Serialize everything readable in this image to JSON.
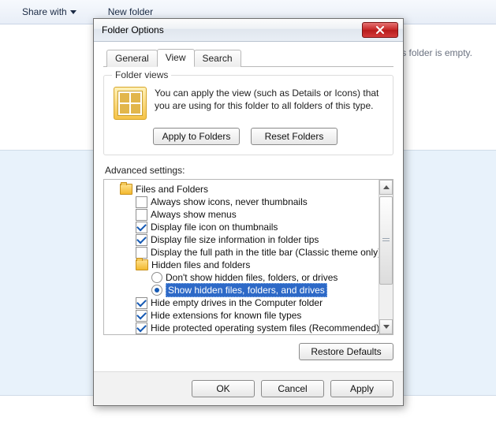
{
  "background": {
    "share_with": "Share with",
    "new_folder": "New folder",
    "empty_hint": "s folder is empty."
  },
  "dialog": {
    "title": "Folder Options",
    "tabs": {
      "general": "General",
      "view": "View",
      "search": "Search"
    },
    "folder_views": {
      "group_label": "Folder views",
      "description": "You can apply the view (such as Details or Icons) that you are using for this folder to all folders of this type.",
      "apply_btn": "Apply to Folders",
      "reset_btn": "Reset Folders"
    },
    "advanced": {
      "label": "Advanced settings:",
      "root": "Files and Folders",
      "items": [
        {
          "type": "check",
          "checked": false,
          "label": "Always show icons, never thumbnails"
        },
        {
          "type": "check",
          "checked": false,
          "label": "Always show menus"
        },
        {
          "type": "check",
          "checked": true,
          "label": "Display file icon on thumbnails"
        },
        {
          "type": "check",
          "checked": true,
          "label": "Display file size information in folder tips"
        },
        {
          "type": "check",
          "checked": false,
          "label": "Display the full path in the title bar (Classic theme only)"
        }
      ],
      "hidden_group": "Hidden files and folders",
      "radios": [
        {
          "checked": false,
          "label": "Don't show hidden files, folders, or drives"
        },
        {
          "checked": true,
          "label": "Show hidden files, folders, and drives",
          "selected": true
        }
      ],
      "items2": [
        {
          "type": "check",
          "checked": true,
          "label": "Hide empty drives in the Computer folder"
        },
        {
          "type": "check",
          "checked": true,
          "label": "Hide extensions for known file types"
        },
        {
          "type": "check",
          "checked": true,
          "label": "Hide protected operating system files (Recommended)"
        }
      ],
      "restore_btn": "Restore Defaults"
    },
    "buttons": {
      "ok": "OK",
      "cancel": "Cancel",
      "apply": "Apply"
    }
  }
}
